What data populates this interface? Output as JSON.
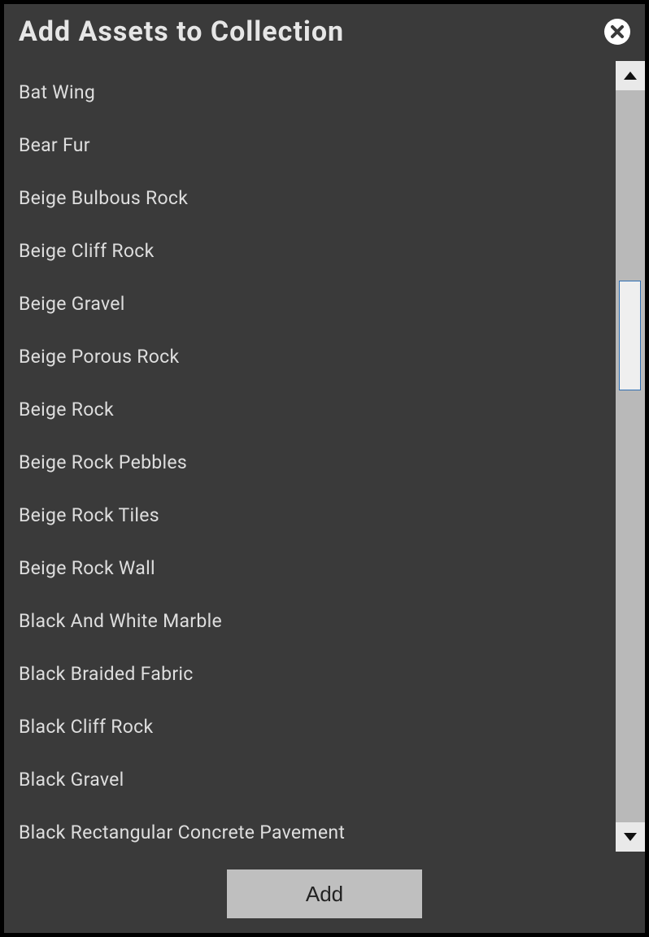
{
  "dialog": {
    "title": "Add Assets to Collection",
    "add_label": "Add"
  },
  "assets": [
    "Bat Wing",
    "Bear Fur",
    "Beige Bulbous Rock",
    "Beige Cliff Rock",
    "Beige Gravel",
    "Beige Porous Rock",
    "Beige Rock",
    "Beige Rock Pebbles",
    "Beige Rock Tiles",
    "Beige Rock Wall",
    "Black And White Marble",
    "Black Braided Fabric",
    "Black Cliff Rock",
    "Black Gravel",
    "Black Rectangular Concrete Pavement"
  ]
}
